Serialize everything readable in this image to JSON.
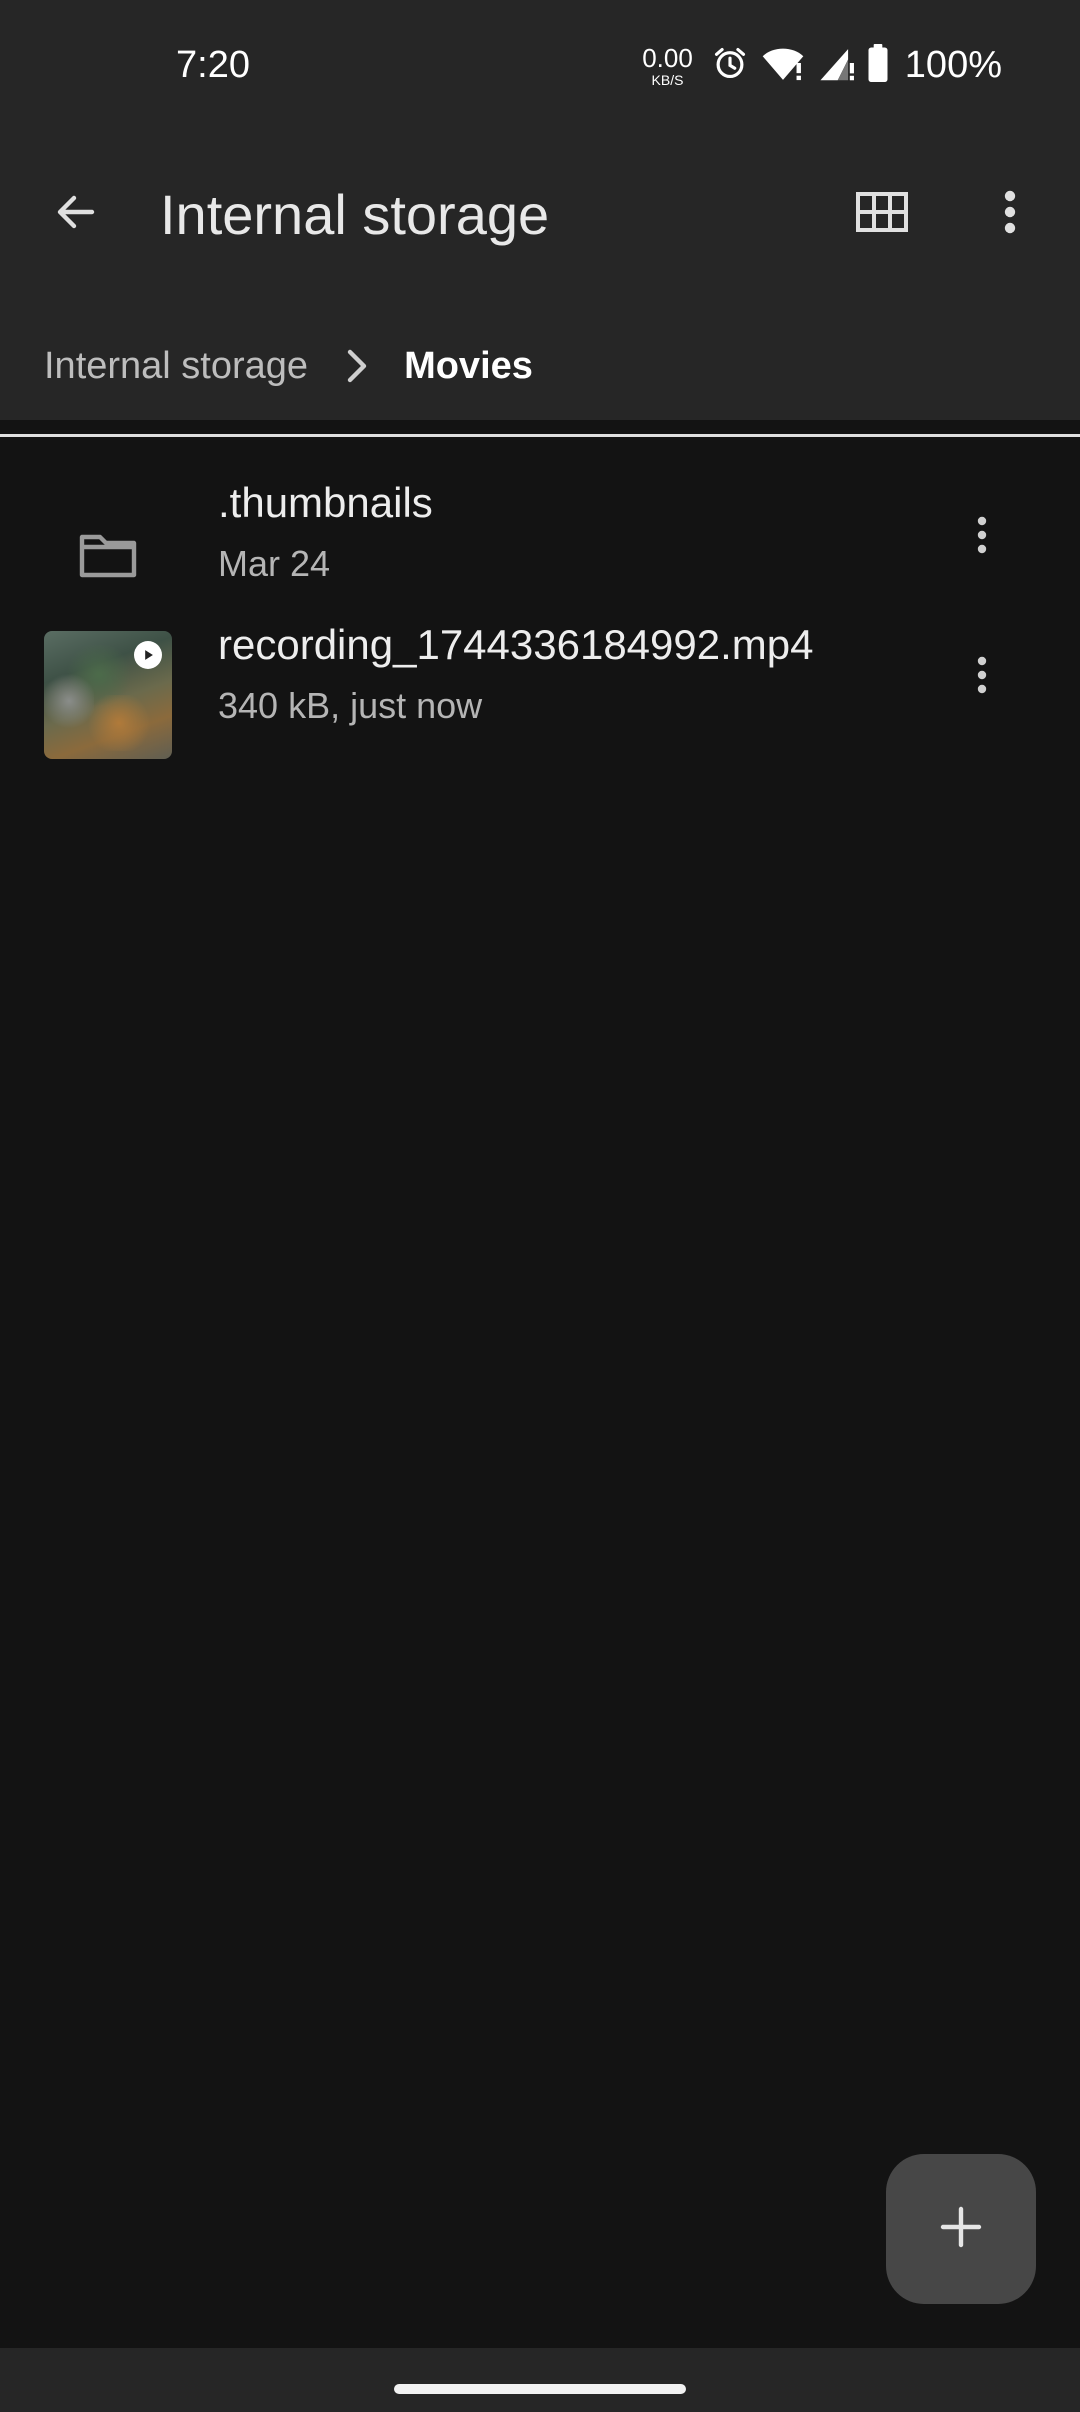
{
  "status_bar": {
    "time": "7:20",
    "net_speed_value": "0.00",
    "net_speed_unit": "KB/S",
    "battery": "100%",
    "icons": [
      "alarm-icon",
      "wifi-icon",
      "signal-icon",
      "battery-icon"
    ]
  },
  "app_bar": {
    "title": "Internal storage",
    "back_icon": "arrow-back-icon",
    "grid_icon": "grid-view-icon",
    "more_icon": "more-vert-icon"
  },
  "breadcrumb": {
    "items": [
      {
        "label": "Internal storage"
      },
      {
        "label": "Movies"
      }
    ],
    "separator_icon": "chevron-right-icon"
  },
  "files": [
    {
      "name": ".thumbnails",
      "meta": "Mar 24",
      "type": "folder",
      "icon": "folder-icon"
    },
    {
      "name": "recording_1744336184992.mp4",
      "meta": "340 kB, just now",
      "type": "video",
      "icon": "play-icon"
    }
  ],
  "fab": {
    "icon": "plus-icon"
  },
  "colors": {
    "background": "#131313",
    "app_bar": "#262626",
    "fab": "#474747",
    "text_primary": "#ededed",
    "text_secondary": "#b5b5b5"
  }
}
